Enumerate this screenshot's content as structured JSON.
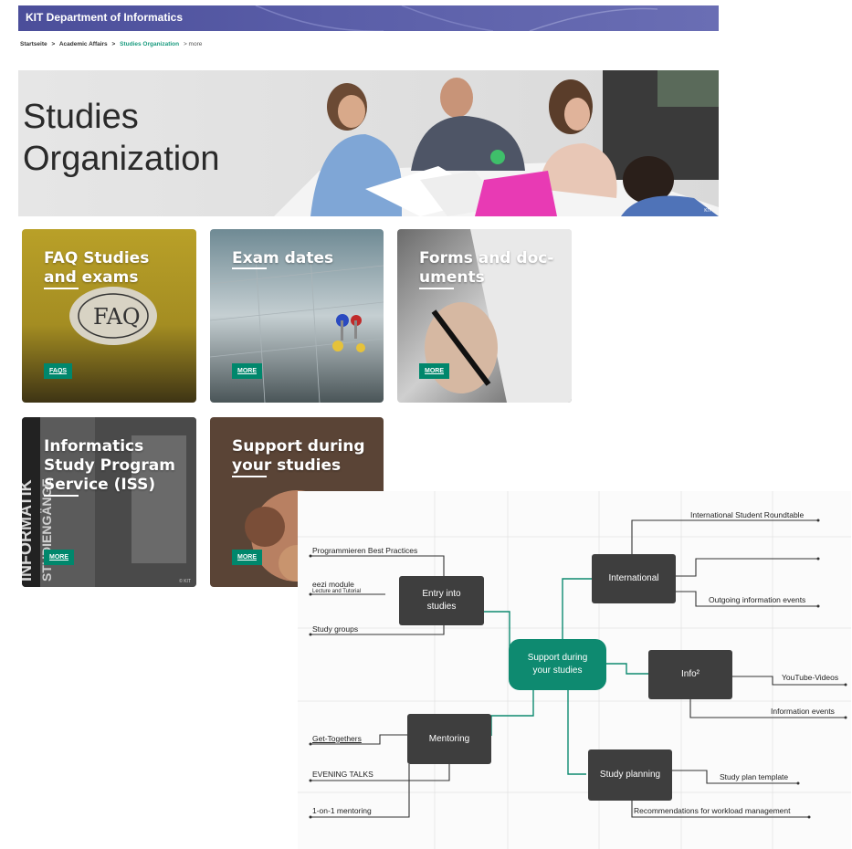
{
  "header": {
    "brand": "KIT Department of Informatics"
  },
  "breadcrumb": {
    "items": [
      "Startseite",
      ">",
      "Academic Affairs",
      ">",
      "Studies Organization",
      "> more"
    ]
  },
  "hero": {
    "title_line1": "Studies",
    "title_line2": "Organization",
    "credit": "KIT"
  },
  "cards": [
    {
      "line1": "FAQ Studies",
      "line2": "and exams",
      "button": "FAQS",
      "image_text": "FAQ"
    },
    {
      "line1": "Exam dates",
      "line2": "",
      "button": "MORE"
    },
    {
      "line1": "Forms and doc-",
      "line2": "uments",
      "button": "MORE"
    },
    {
      "line1": "Informatics",
      "line2": "Study Program",
      "line3": "Service (ISS)",
      "button": "MORE",
      "credit": "© KIT"
    },
    {
      "line1": "Support during",
      "line2": "your studies",
      "button": "MORE"
    }
  ],
  "mindmap": {
    "center": {
      "line1": "Support during",
      "line2": "your studies"
    },
    "nodes": {
      "entry": {
        "line1": "Entry into",
        "line2": "studies"
      },
      "international": "International",
      "info": "Info²",
      "mentoring": "Mentoring",
      "planning": "Study planning"
    },
    "leaves": {
      "best_practices": "Programmieren Best Practices",
      "eezi": "eezi module",
      "eezi_sub": "Lecture and Tutorial",
      "study_groups": "Study groups",
      "roundtable": "International Student Roundtable",
      "outgoing": "Outgoing information events",
      "youtube": "YouTube-Videos",
      "info_events": "Information events",
      "get_together": "Get-Togethers",
      "evening": "EVENING TALKS",
      "mentoring_1on1": "1-on-1 mentoring",
      "plan_template": "Study plan template",
      "workload": "Recommendations for workload management"
    }
  },
  "colors": {
    "accent": "#00876c",
    "topbar": "#4b4e9a",
    "node": "#3e3e3e"
  }
}
